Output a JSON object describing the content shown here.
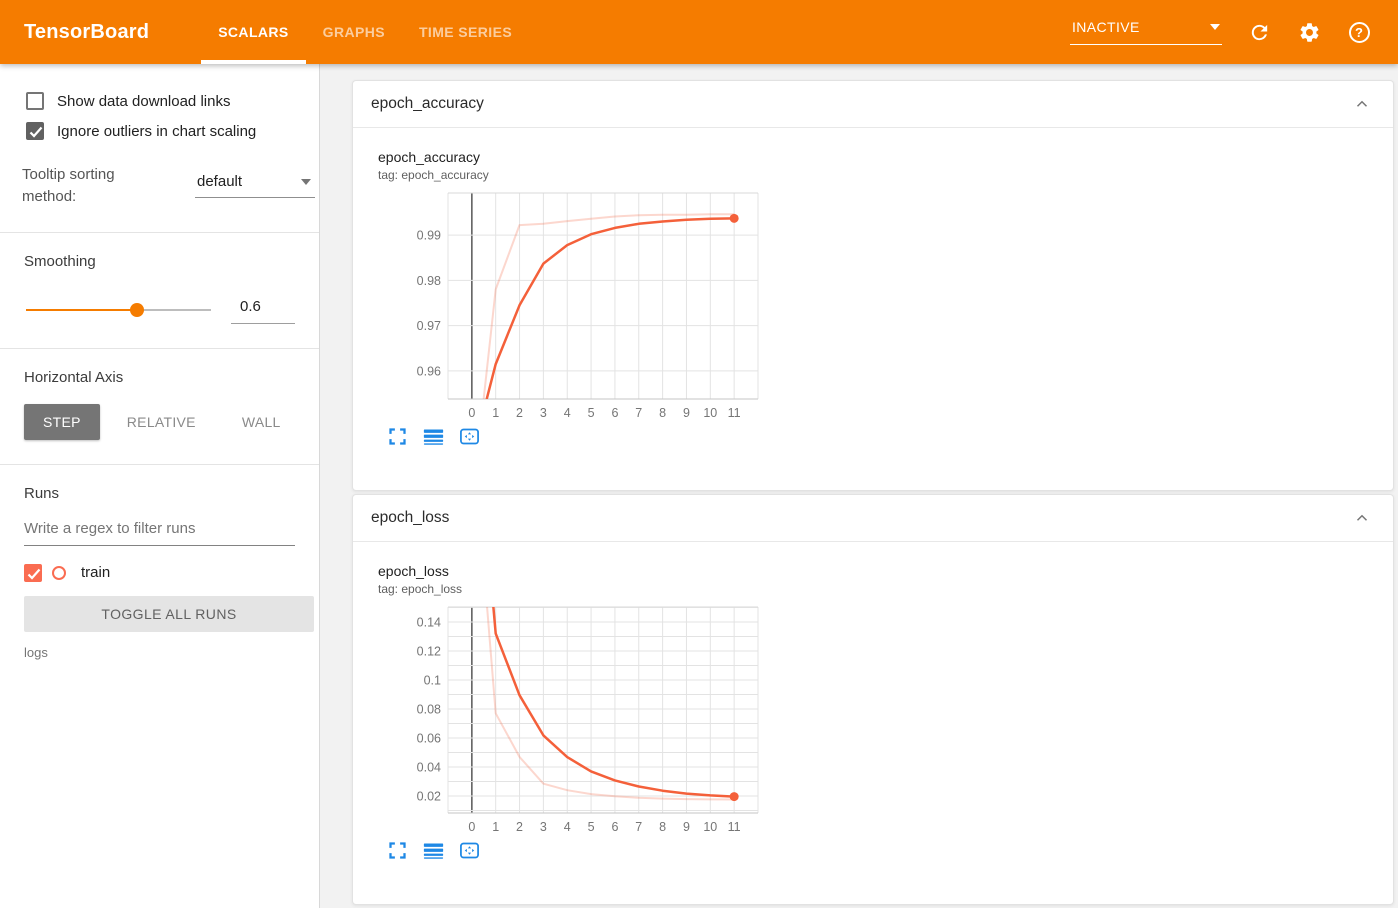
{
  "header": {
    "title": "TensorBoard",
    "tabs": [
      {
        "label": "SCALARS",
        "active": true
      },
      {
        "label": "GRAPHS",
        "active": false
      },
      {
        "label": "TIME SERIES",
        "active": false
      }
    ],
    "status": "INACTIVE"
  },
  "sidebar": {
    "show_download_label": "Show data download links",
    "ignore_outliers_label": "Ignore outliers in chart scaling",
    "tooltip_sorting_label": "Tooltip sorting method:",
    "tooltip_sorting_value": "default",
    "smoothing": {
      "label": "Smoothing",
      "value": "0.6",
      "fraction": 0.6
    },
    "horizontal_axis": {
      "label": "Horizontal Axis",
      "options": [
        {
          "label": "STEP",
          "active": true
        },
        {
          "label": "RELATIVE",
          "active": false
        },
        {
          "label": "WALL",
          "active": false
        }
      ]
    },
    "runs": {
      "label": "Runs",
      "filter_placeholder": "Write a regex to filter runs",
      "items": [
        {
          "name": "train",
          "checked": true,
          "color": "#fa6c51"
        }
      ],
      "toggle_all_label": "TOGGLE ALL RUNS",
      "directory": "logs"
    }
  },
  "cards": [
    {
      "header": "epoch_accuracy"
    },
    {
      "header": "epoch_loss"
    }
  ],
  "chart_data": [
    {
      "type": "line",
      "title": "epoch_accuracy",
      "subtitle": "tag: epoch_accuracy",
      "x": [
        0,
        1,
        2,
        3,
        4,
        5,
        6,
        7,
        8,
        9,
        10,
        11
      ],
      "series": [
        {
          "name": "train (unsmoothed)",
          "values": [
            0.93,
            0.978,
            0.9922,
            0.9925,
            0.9931,
            0.9936,
            0.9941,
            0.9944,
            0.9945,
            0.9945,
            0.9946,
            0.9946
          ],
          "color": "#f4603a",
          "opacity": 0.25,
          "width": 2,
          "end_dot": false
        },
        {
          "name": "train (smoothed 0.6)",
          "values": [
            0.941,
            0.9615,
            0.9745,
            0.9837,
            0.9878,
            0.9902,
            0.9916,
            0.9925,
            0.993,
            0.9934,
            0.9936,
            0.9937
          ],
          "color": "#f4603a",
          "opacity": 1,
          "width": 2.5,
          "end_dot": true
        }
      ],
      "xlim": [
        -1,
        12
      ],
      "ylim": [
        0.9538,
        0.9993
      ],
      "xticks": [
        0,
        1,
        2,
        3,
        4,
        5,
        6,
        7,
        8,
        9,
        10,
        11
      ],
      "yticks": [
        0.96,
        0.97,
        0.98,
        0.99
      ],
      "ytick_labels": [
        "0.96",
        "0.97",
        "0.98",
        "0.99"
      ],
      "minor_yticks": [],
      "zero_axis_x": 0,
      "grid": true,
      "legend_position": "none"
    },
    {
      "type": "line",
      "title": "epoch_loss",
      "subtitle": "tag: epoch_loss",
      "x": [
        0,
        1,
        2,
        3,
        4,
        5,
        6,
        7,
        8,
        9,
        10,
        11
      ],
      "series": [
        {
          "name": "train (unsmoothed)",
          "values": [
            0.28,
            0.077,
            0.047,
            0.0285,
            0.024,
            0.0213,
            0.0198,
            0.0188,
            0.0182,
            0.0179,
            0.0177,
            0.0176
          ],
          "color": "#f4603a",
          "opacity": 0.25,
          "width": 2,
          "end_dot": false
        },
        {
          "name": "train (smoothed 0.6)",
          "values": [
            0.32,
            0.132,
            0.0895,
            0.0618,
            0.0468,
            0.037,
            0.0308,
            0.0266,
            0.0237,
            0.0217,
            0.0204,
            0.0196
          ],
          "color": "#f4603a",
          "opacity": 1,
          "width": 2.5,
          "end_dot": true
        }
      ],
      "xlim": [
        -1,
        12
      ],
      "ylim": [
        0.0083,
        0.1503
      ],
      "xticks": [
        0,
        1,
        2,
        3,
        4,
        5,
        6,
        7,
        8,
        9,
        10,
        11
      ],
      "yticks": [
        0.02,
        0.04,
        0.06,
        0.08,
        0.1,
        0.12,
        0.14
      ],
      "ytick_labels": [
        "0.02",
        "0.04",
        "0.06",
        "0.08",
        "0.1",
        "0.12",
        "0.14"
      ],
      "minor_yticks": [
        0.01,
        0.03,
        0.05,
        0.07,
        0.09,
        0.11,
        0.13,
        0.15
      ],
      "zero_axis_x": 0,
      "grid": true,
      "legend_position": "none"
    }
  ],
  "colors": {
    "accent": "#f57c00",
    "run_color": "#fa6c51",
    "line_color": "#f4603a",
    "icon_blue": "#1e88e5",
    "grid": "#e3e3e3",
    "tick_text": "#757575"
  }
}
